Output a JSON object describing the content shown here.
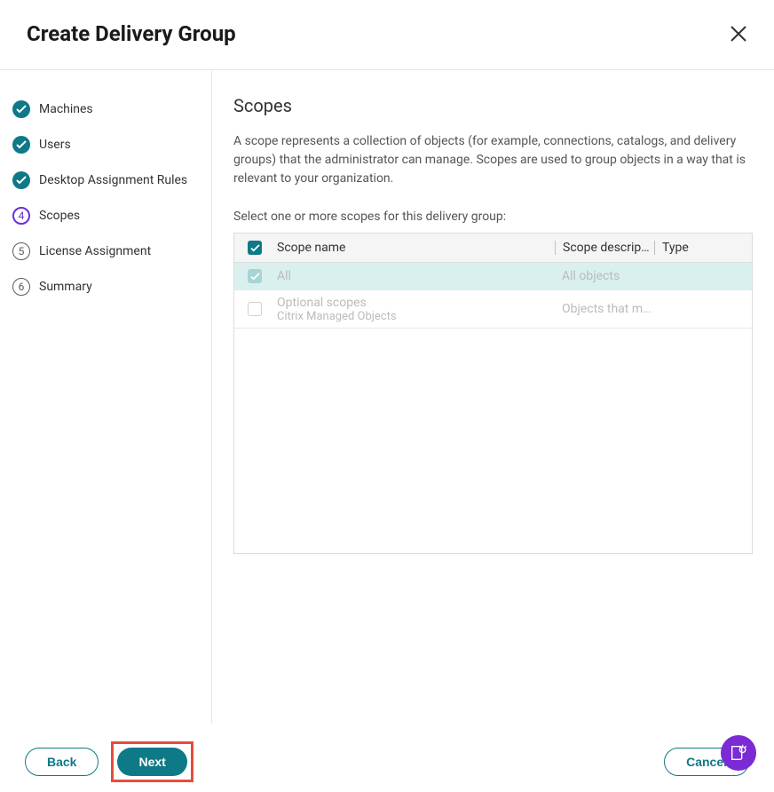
{
  "header": {
    "title": "Create Delivery Group"
  },
  "steps": [
    {
      "label": "Machines",
      "state": "done"
    },
    {
      "label": "Users",
      "state": "done"
    },
    {
      "label": "Desktop Assignment Rules",
      "state": "done"
    },
    {
      "label": "Scopes",
      "state": "current",
      "num": "4"
    },
    {
      "label": "License Assignment",
      "state": "pending",
      "num": "5"
    },
    {
      "label": "Summary",
      "state": "pending",
      "num": "6"
    }
  ],
  "main": {
    "heading": "Scopes",
    "description": "A scope represents a collection of objects (for example, connections, catalogs, and delivery groups) that the administrator can manage. Scopes are used to group objects in a way that is relevant to your organization.",
    "subtext": "Select one or more scopes for this delivery group:",
    "columns": {
      "name": "Scope name",
      "desc": "Scope descrip…",
      "type": "Type"
    },
    "rows": [
      {
        "name": "All",
        "sub": "",
        "desc": "All objects",
        "type": "",
        "checked": true,
        "selected": true
      },
      {
        "name": "Optional scopes",
        "sub": "Citrix Managed Objects",
        "desc": "Objects that m…",
        "type": "",
        "checked": false,
        "selected": false
      }
    ]
  },
  "footer": {
    "back": "Back",
    "next": "Next",
    "cancel": "Cancel"
  }
}
